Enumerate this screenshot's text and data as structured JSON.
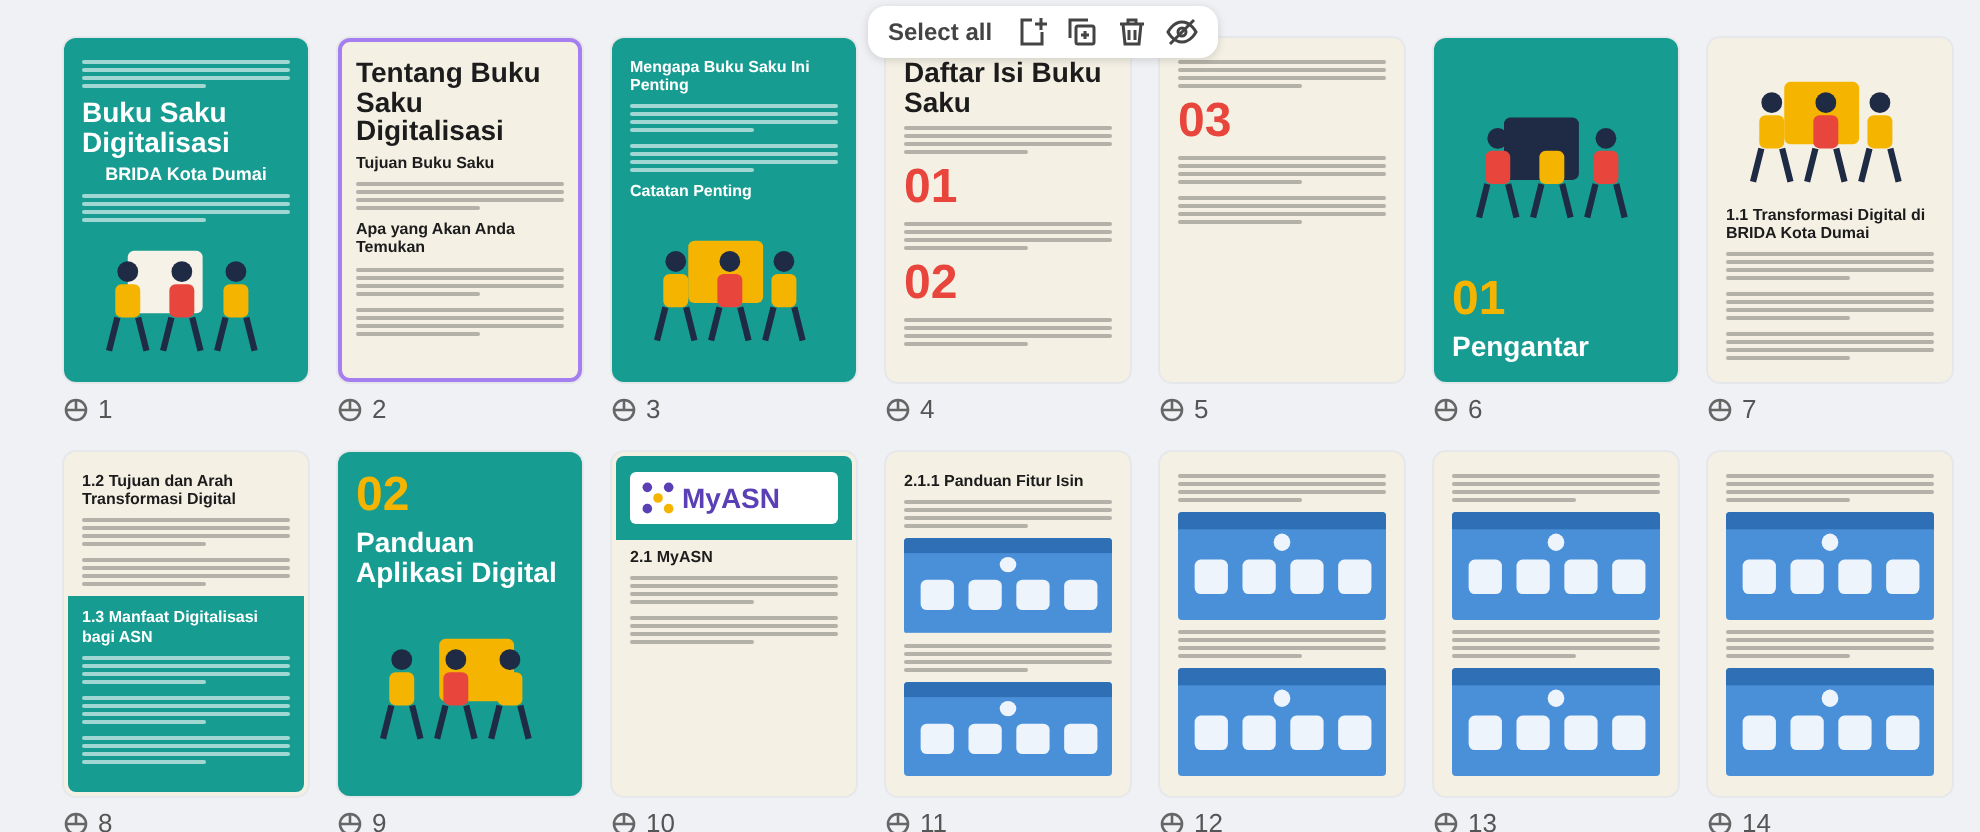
{
  "toolbar": {
    "label": "Select all"
  },
  "pages": [
    {
      "number": "1",
      "selected": false,
      "kind": "dark",
      "blocks": [
        {
          "kind": "lines"
        },
        {
          "kind": "title",
          "text": "Buku Saku Digitalisasi"
        },
        {
          "kind": "subtitle",
          "text": "BRIDA Kota Dumai"
        },
        {
          "kind": "lines"
        },
        {
          "kind": "art"
        }
      ]
    },
    {
      "number": "2",
      "selected": true,
      "kind": "light",
      "blocks": [
        {
          "kind": "title",
          "text": "Tentang Buku Saku Digitalisasi"
        },
        {
          "kind": "heading",
          "text": "Tujuan Buku Saku"
        },
        {
          "kind": "lines"
        },
        {
          "kind": "heading",
          "text": "Apa yang Akan Anda Temukan"
        },
        {
          "kind": "lines"
        },
        {
          "kind": "lines"
        }
      ]
    },
    {
      "number": "3",
      "selected": false,
      "kind": "dark",
      "blocks": [
        {
          "kind": "heading",
          "text": "Mengapa Buku Saku Ini Penting"
        },
        {
          "kind": "lines"
        },
        {
          "kind": "lines"
        },
        {
          "kind": "heading",
          "text": "Catatan Penting"
        },
        {
          "kind": "art"
        }
      ]
    },
    {
      "number": "4",
      "selected": false,
      "kind": "light",
      "blocks": [
        {
          "kind": "title",
          "text": "Daftar Isi Buku Saku"
        },
        {
          "kind": "lines"
        },
        {
          "kind": "accent",
          "text": "01"
        },
        {
          "kind": "lines"
        },
        {
          "kind": "accent",
          "text": "02"
        },
        {
          "kind": "lines"
        }
      ]
    },
    {
      "number": "5",
      "selected": false,
      "kind": "light",
      "blocks": [
        {
          "kind": "lines"
        },
        {
          "kind": "accent",
          "text": "03"
        },
        {
          "kind": "lines"
        },
        {
          "kind": "lines"
        }
      ]
    },
    {
      "number": "6",
      "selected": false,
      "kind": "dark",
      "blocks": [
        {
          "kind": "art"
        },
        {
          "kind": "accent",
          "text": "01"
        },
        {
          "kind": "title",
          "text": "Pengantar"
        }
      ]
    },
    {
      "number": "7",
      "selected": false,
      "kind": "light",
      "blocks": [
        {
          "kind": "art"
        },
        {
          "kind": "heading",
          "text": "1.1 Transformasi Digital di BRIDA Kota Dumai"
        },
        {
          "kind": "lines"
        },
        {
          "kind": "lines"
        },
        {
          "kind": "lines"
        }
      ]
    },
    {
      "number": "8",
      "selected": false,
      "kind": "light",
      "blocks": [
        {
          "kind": "heading",
          "text": "1.2 Tujuan dan Arah Transformasi Digital"
        },
        {
          "kind": "lines"
        },
        {
          "kind": "lines"
        },
        {
          "kind": "panel",
          "blocks": [
            {
              "kind": "heading",
              "text": "1.3 Manfaat Digitalisasi bagi ASN"
            },
            {
              "kind": "lines"
            },
            {
              "kind": "lines"
            },
            {
              "kind": "lines"
            }
          ]
        }
      ]
    },
    {
      "number": "9",
      "selected": false,
      "kind": "dark",
      "blocks": [
        {
          "kind": "accent",
          "text": "02"
        },
        {
          "kind": "title",
          "text": "Panduan Aplikasi Digital"
        },
        {
          "kind": "art"
        }
      ]
    },
    {
      "number": "10",
      "selected": false,
      "kind": "light",
      "blocks": [
        {
          "kind": "panel",
          "blocks": [
            {
              "kind": "logo",
              "text": "MyASN"
            }
          ]
        },
        {
          "kind": "heading",
          "text": "2.1 MyASN"
        },
        {
          "kind": "lines"
        },
        {
          "kind": "lines"
        }
      ]
    },
    {
      "number": "11",
      "selected": false,
      "kind": "light",
      "blocks": [
        {
          "kind": "heading",
          "text": "2.1.1 Panduan Fitur Isin"
        },
        {
          "kind": "lines"
        },
        {
          "kind": "shot"
        },
        {
          "kind": "lines"
        },
        {
          "kind": "shot"
        }
      ]
    },
    {
      "number": "12",
      "selected": false,
      "kind": "light",
      "blocks": [
        {
          "kind": "lines"
        },
        {
          "kind": "shot"
        },
        {
          "kind": "lines"
        },
        {
          "kind": "shot"
        }
      ]
    },
    {
      "number": "13",
      "selected": false,
      "kind": "light",
      "blocks": [
        {
          "kind": "lines"
        },
        {
          "kind": "shot"
        },
        {
          "kind": "lines"
        },
        {
          "kind": "shot"
        }
      ]
    },
    {
      "number": "14",
      "selected": false,
      "kind": "light",
      "blocks": [
        {
          "kind": "lines"
        },
        {
          "kind": "shot"
        },
        {
          "kind": "lines"
        },
        {
          "kind": "shot"
        }
      ]
    }
  ]
}
